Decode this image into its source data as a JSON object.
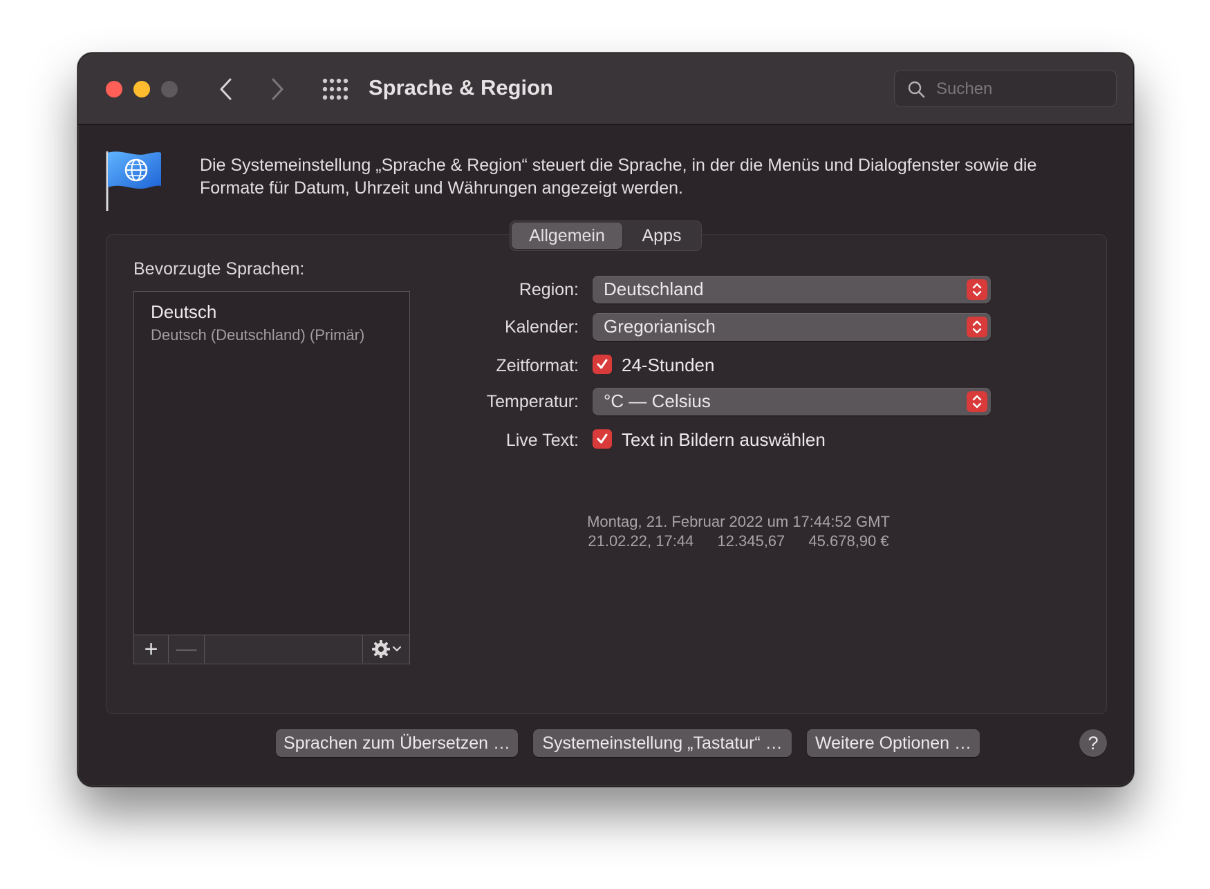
{
  "window": {
    "title": "Sprache & Region",
    "search_placeholder": "Suchen"
  },
  "header": {
    "description": "Die Systemeinstellung „Sprache & Region“ steuert die Sprache, in der die Menüs und Dialogfenster sowie die Formate für Datum, Uhrzeit und Währungen angezeigt werden."
  },
  "tabs": [
    {
      "label": "Allgemein",
      "active": true
    },
    {
      "label": "Apps",
      "active": false
    }
  ],
  "languages": {
    "label": "Bevorzugte Sprachen:",
    "items": [
      {
        "name": "Deutsch",
        "detail": "Deutsch (Deutschland) (Primär)"
      }
    ],
    "add_symbol": "+",
    "remove_symbol": "—"
  },
  "settings": {
    "region": {
      "label": "Region:",
      "value": "Deutschland"
    },
    "calendar": {
      "label": "Kalender:",
      "value": "Gregorianisch"
    },
    "time_format": {
      "label": "Zeitformat:",
      "checkbox_label": "24-Stunden",
      "checked": true
    },
    "temperature": {
      "label": "Temperatur:",
      "value": "°C — Celsius"
    },
    "live_text": {
      "label": "Live Text:",
      "checkbox_label": "Text in Bildern auswählen",
      "checked": true
    }
  },
  "preview": {
    "long_date": "Montag, 21. Februar 2022 um 17:44:52 GMT",
    "short_date": "21.02.22, 17:44",
    "number": "12.345,67",
    "currency": "45.678,90 €"
  },
  "buttons": {
    "translate_languages": "Sprachen zum Übersetzen …",
    "keyboard_prefs": "Systemeinstellung „Tastatur“ …",
    "more_options": "Weitere Optionen …",
    "help": "?"
  },
  "colors": {
    "accent": "#d93b3b",
    "window_bg": "#2b2529",
    "titlebar_bg": "#3a3538"
  }
}
